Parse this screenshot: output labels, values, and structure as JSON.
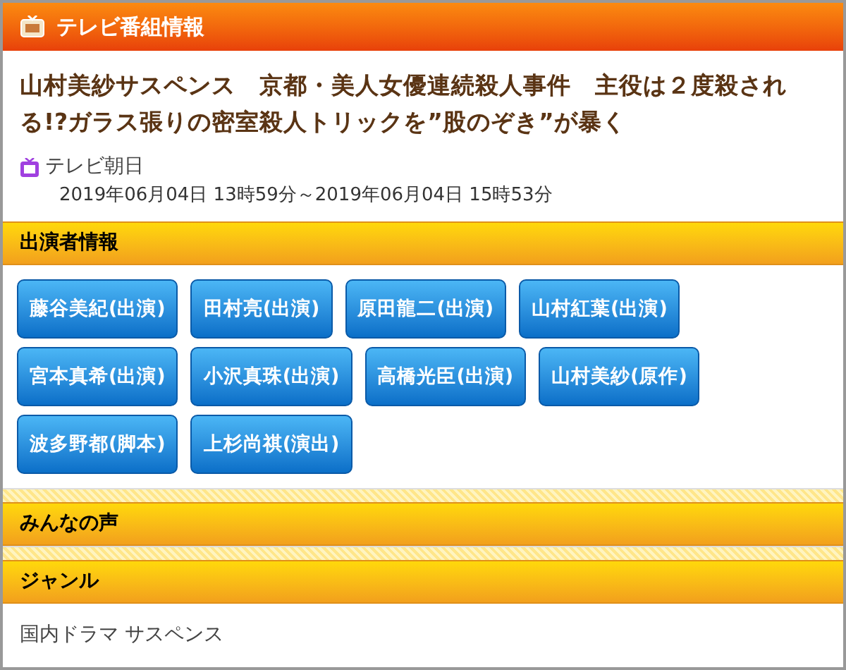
{
  "header": {
    "title": "テレビ番組情報"
  },
  "program": {
    "title": "山村美紗サスペンス　京都・美人女優連続殺人事件　主役は２度殺される!?ガラス張りの密室殺人トリックを”股のぞき”が暴く",
    "channel": "テレビ朝日",
    "airtime": "2019年06月04日 13時59分～2019年06月04日 15時53分"
  },
  "cast": {
    "heading": "出演者情報",
    "people": [
      {
        "label": "藤谷美紀(出演)"
      },
      {
        "label": "田村亮(出演)"
      },
      {
        "label": "原田龍二(出演)"
      },
      {
        "label": "山村紅葉(出演)"
      },
      {
        "label": "宮本真希(出演)"
      },
      {
        "label": "小沢真珠(出演)"
      },
      {
        "label": "高橋光臣(出演)"
      },
      {
        "label": "山村美紗(原作)"
      },
      {
        "label": "波多野都(脚本)"
      },
      {
        "label": "上杉尚祺(演出)"
      }
    ]
  },
  "voices": {
    "heading": "みんなの声"
  },
  "genre": {
    "heading": "ジャンル",
    "text": "国内ドラマ サスペンス"
  }
}
